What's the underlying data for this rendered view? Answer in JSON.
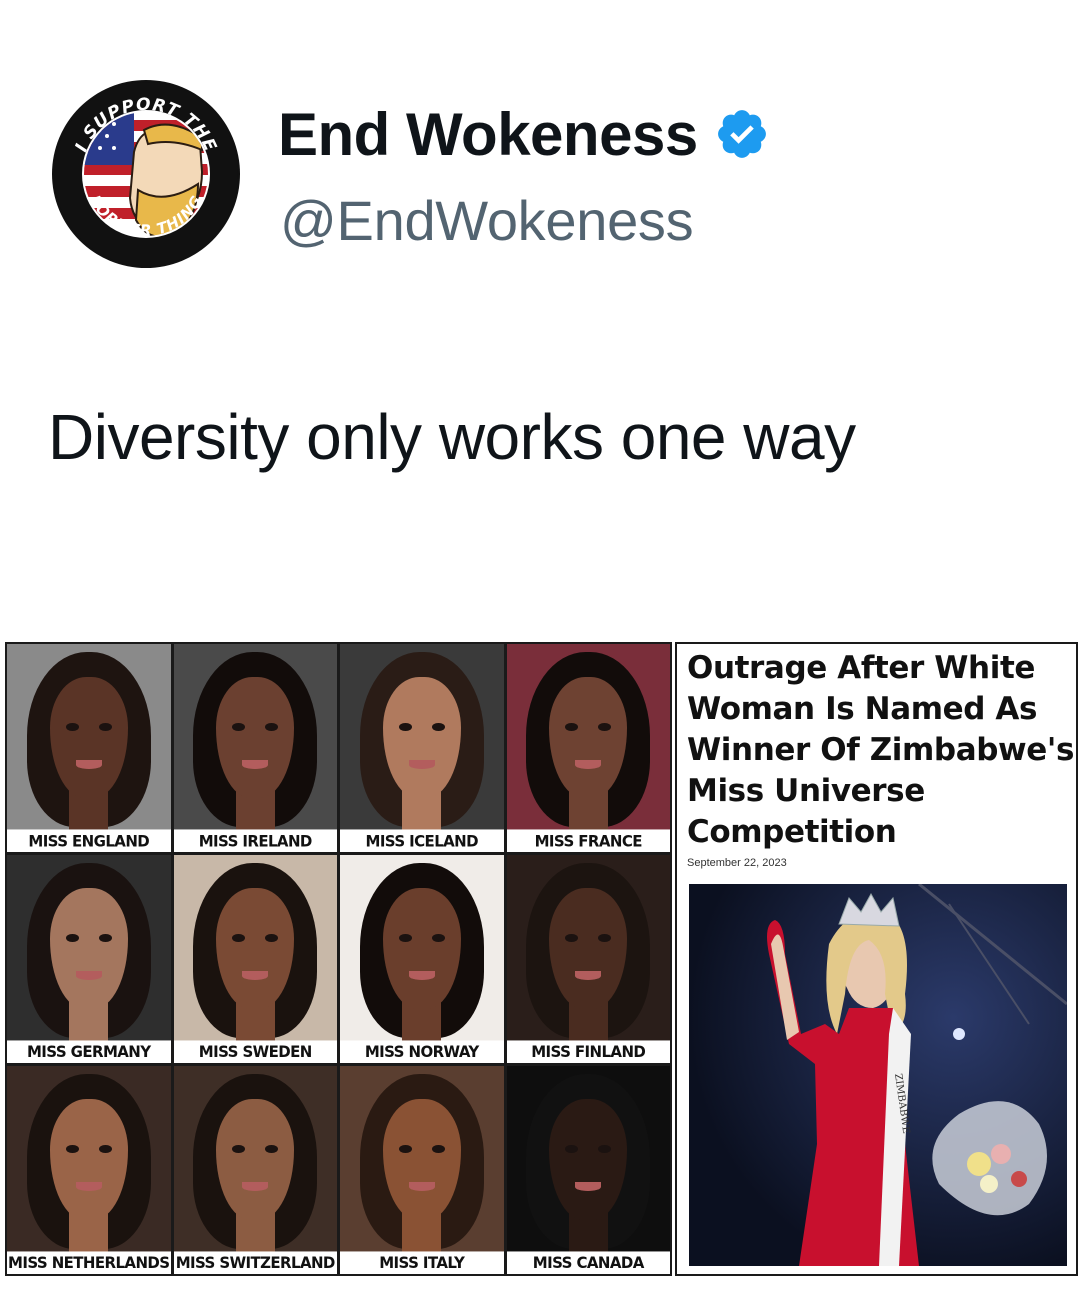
{
  "tweet": {
    "display_name": "End Wokeness",
    "handle": "@EndWokeness",
    "text": "Diversity only works one way",
    "verified": true,
    "verified_color": "#1d9bf0",
    "avatar": {
      "top_text": "I SUPPORT THE",
      "bottom_text": "FORMER THING"
    }
  },
  "image": {
    "grid": [
      {
        "caption": "MISS ENGLAND",
        "skin": "#5a3426",
        "hair": "#1e1410",
        "bg": "#8a8a8a"
      },
      {
        "caption": "MISS IRELAND",
        "skin": "#6b4030",
        "hair": "#120c0a",
        "bg": "#4a4a4a"
      },
      {
        "caption": "MISS ICELAND",
        "skin": "#b07a5e",
        "hair": "#2a1c16",
        "bg": "#3a3a3a"
      },
      {
        "caption": "MISS FRANCE",
        "skin": "#6e4232",
        "hair": "#120c0a",
        "bg": "#7a2e3a"
      },
      {
        "caption": "MISS GERMANY",
        "skin": "#a4765e",
        "hair": "#1a1210",
        "bg": "#2e2e2e"
      },
      {
        "caption": "MISS SWEDEN",
        "skin": "#7a4a34",
        "hair": "#1a120e",
        "bg": "#c8b8a8"
      },
      {
        "caption": "MISS NORWAY",
        "skin": "#6a3e2c",
        "hair": "#120c0a",
        "bg": "#f0ece8"
      },
      {
        "caption": "MISS FINLAND",
        "skin": "#4a2c20",
        "hair": "#1c1410",
        "bg": "#2a1e1a"
      },
      {
        "caption": "MISS NETHERLANDS",
        "skin": "#9a6448",
        "hair": "#1a120e",
        "bg": "#3a2a24"
      },
      {
        "caption": "MISS SWITZERLAND",
        "skin": "#8c5c42",
        "hair": "#1a120e",
        "bg": "#3e2e26"
      },
      {
        "caption": "MISS ITALY",
        "skin": "#8a5234",
        "hair": "#2a1a12",
        "bg": "#5a3e30"
      },
      {
        "caption": "MISS CANADA",
        "skin": "#2a1a14",
        "hair": "#111111",
        "bg": "#0e0e0e"
      }
    ],
    "article": {
      "headline": "Outrage After White Woman Is Named As Winner Of Zimbabwe's Miss Universe Competition",
      "date": "September 22, 2023",
      "sash_text": "ZIMBABWE"
    }
  }
}
